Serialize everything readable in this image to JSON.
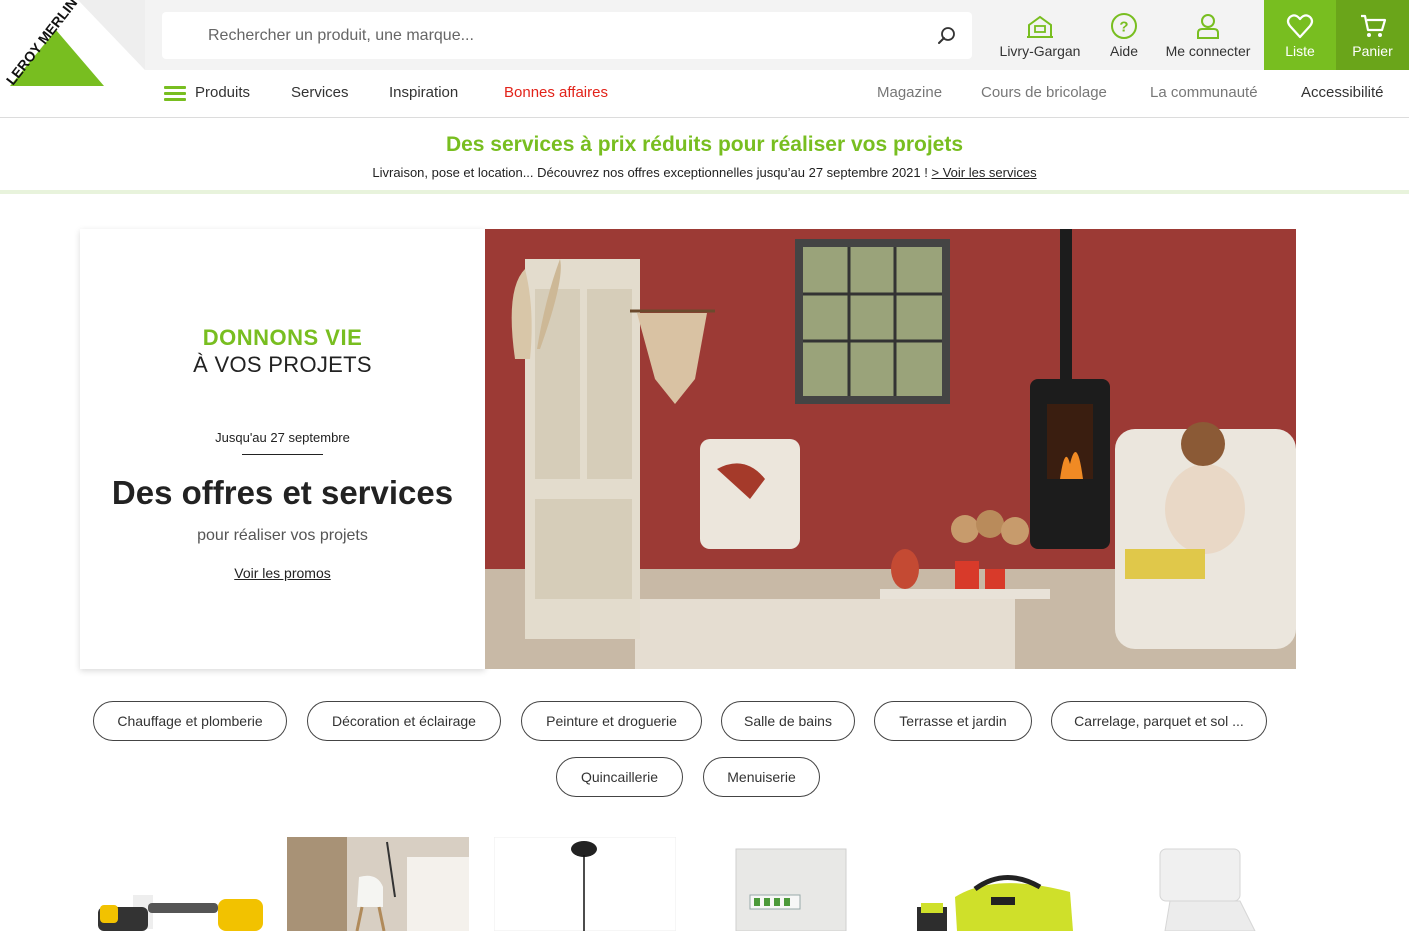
{
  "header": {
    "brand": "LEROY MERLIN",
    "search_placeholder": "Rechercher un produit, une marque...",
    "store_label": "Livry-Gargan",
    "help_label": "Aide",
    "login_label": "Me connecter",
    "list_label": "Liste",
    "cart_label": "Panier"
  },
  "nav": {
    "products": "Produits",
    "services": "Services",
    "inspiration": "Inspiration",
    "deals": "Bonnes affaires",
    "magazine": "Magazine",
    "diy_courses": "Cours de bricolage",
    "community": "La communauté",
    "accessibility": "Accessibilité"
  },
  "promo": {
    "title": "Des services à prix réduits pour réaliser vos projets",
    "text": "Livraison, pose et location... Découvrez nos offres exceptionnelles jusqu’au 27 septembre 2021 !",
    "link": "> Voir les services"
  },
  "hero": {
    "slogan_line1": "DONNONS VIE",
    "slogan_line2": "À VOS PROJETS",
    "date": "Jusqu'au 27 septembre",
    "title": "Des offres et services",
    "subtitle": "pour réaliser vos projets",
    "link": "Voir les promos"
  },
  "categories": [
    "Chauffage et plomberie",
    "Décoration et éclairage",
    "Peinture et droguerie",
    "Salle de bains",
    "Terrasse et jardin",
    "Carrelage, parquet et sol ...",
    "Quincaillerie",
    "Menuiserie"
  ],
  "colors": {
    "brand_green": "#78be20",
    "deal_red": "#e2231a",
    "wall_red": "#9c3a35"
  }
}
